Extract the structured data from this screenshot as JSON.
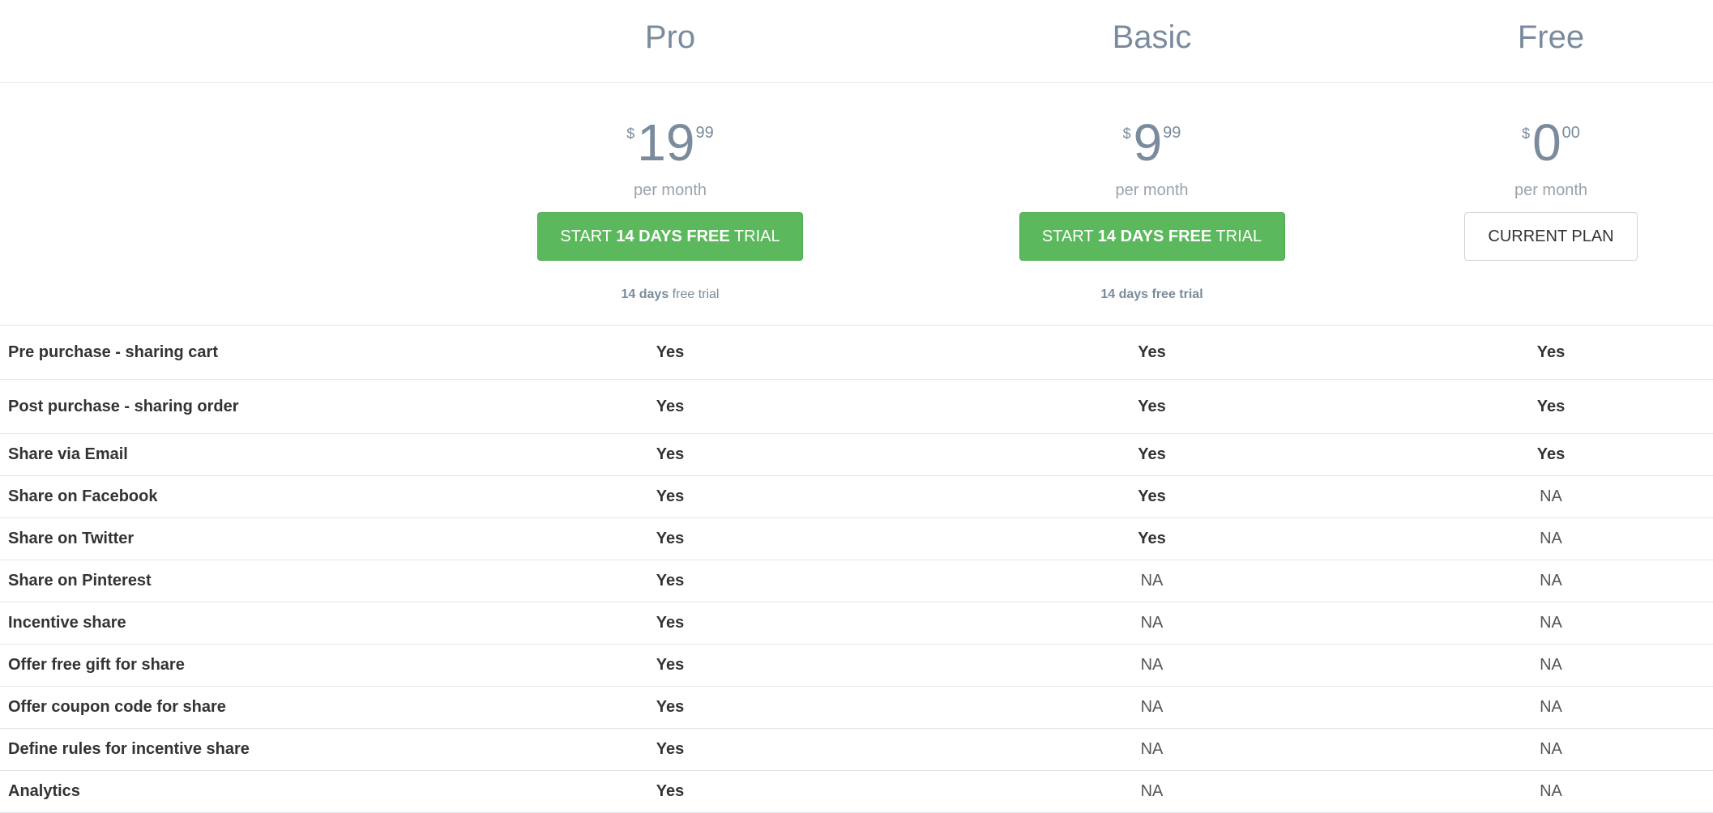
{
  "plans": [
    {
      "name": "Pro",
      "currency": "$",
      "price_major": "19",
      "price_minor": "99",
      "period": "per month",
      "cta": {
        "type": "primary",
        "pre": "START ",
        "bold": "14 DAYS FREE",
        "post": " TRIAL"
      },
      "trial_note": {
        "bold": "14 days",
        "rest": " free trial"
      }
    },
    {
      "name": "Basic",
      "currency": "$",
      "price_major": "9",
      "price_minor": "99",
      "period": "per month",
      "cta": {
        "type": "primary",
        "pre": "START ",
        "bold": "14 DAYS FREE",
        "post": " TRIAL"
      },
      "trial_note": {
        "bold": "14 days free trial",
        "rest": ""
      }
    },
    {
      "name": "Free",
      "currency": "$",
      "price_major": "0",
      "price_minor": "00",
      "period": "per month",
      "cta": {
        "type": "secondary",
        "label": "CURRENT PLAN"
      },
      "trial_note": null
    }
  ],
  "features": [
    {
      "name": "Pre purchase - sharing cart",
      "values": [
        "Yes",
        "Yes",
        "Yes"
      ]
    },
    {
      "name": "Post purchase - sharing order",
      "values": [
        "Yes",
        "Yes",
        "Yes"
      ]
    },
    {
      "name": "Share via Email",
      "values": [
        "Yes",
        "Yes",
        "Yes"
      ]
    },
    {
      "name": "Share on Facebook",
      "values": [
        "Yes",
        "Yes",
        "NA"
      ]
    },
    {
      "name": "Share on Twitter",
      "values": [
        "Yes",
        "Yes",
        "NA"
      ]
    },
    {
      "name": "Share on Pinterest",
      "values": [
        "Yes",
        "NA",
        "NA"
      ]
    },
    {
      "name": "Incentive share",
      "values": [
        "Yes",
        "NA",
        "NA"
      ]
    },
    {
      "name": "Offer free gift for share",
      "values": [
        "Yes",
        "NA",
        "NA"
      ]
    },
    {
      "name": "Offer coupon code for share",
      "values": [
        "Yes",
        "NA",
        "NA"
      ]
    },
    {
      "name": "Define rules for incentive share",
      "values": [
        "Yes",
        "NA",
        "NA"
      ]
    },
    {
      "name": "Analytics",
      "values": [
        "Yes",
        "NA",
        "NA"
      ]
    }
  ],
  "colors": {
    "accent_green": "#5cb85c",
    "heading_slate": "#7a8b9d",
    "divider": "#e2e5e8"
  }
}
